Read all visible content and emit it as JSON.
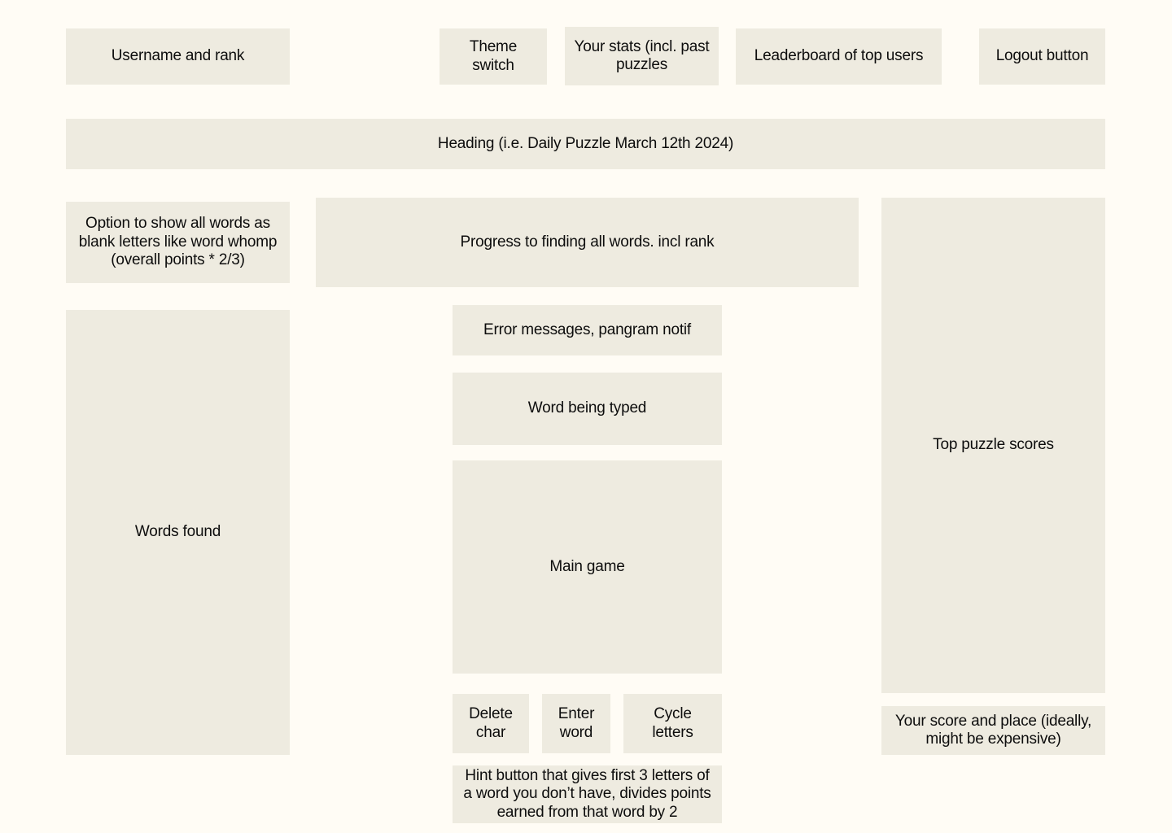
{
  "theme": {
    "page_background": "#fffcf5",
    "block_fill": "#eeebe0",
    "text_color": "#0d0d0d"
  },
  "header": {
    "username_rank": "Username and rank",
    "theme_switch": "Theme switch",
    "your_stats": "Your stats (incl. past puzzles",
    "leaderboard": "Leaderboard of top users",
    "logout": "Logout button"
  },
  "heading": {
    "title": "Heading (i.e. Daily Puzzle March 12th 2024)"
  },
  "left_column": {
    "blank_letters_option": "Option to show all words as blank letters like word whomp (overall points * 2/3)",
    "words_found": "Words found"
  },
  "center_column": {
    "progress": "Progress to finding all words. incl rank",
    "error_messages": "Error messages, pangram notif",
    "word_being_typed": "Word being typed",
    "main_game": "Main game",
    "delete_char": "Delete char",
    "enter_word": "Enter word",
    "cycle_letters": "Cycle letters",
    "hint_button": "Hint button that gives first 3 letters of a word you don’t have, divides points earned from that word by 2"
  },
  "right_column": {
    "top_puzzle_scores": "Top puzzle scores",
    "your_score_and_place": "Your score and place (ideally, might be expensive)"
  }
}
